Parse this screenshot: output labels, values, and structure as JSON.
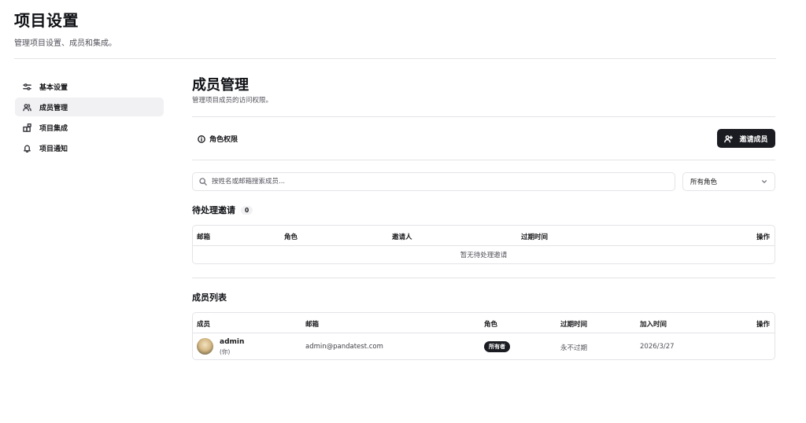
{
  "page": {
    "title": "项目设置",
    "subtitle": "管理项目设置、成员和集成。"
  },
  "sidebar": {
    "items": [
      {
        "label": "基本设置",
        "icon": "settings-sliders-icon",
        "active": false
      },
      {
        "label": "成员管理",
        "icon": "users-icon",
        "active": true
      },
      {
        "label": "项目集成",
        "icon": "puzzle-icon",
        "active": false
      },
      {
        "label": "项目通知",
        "icon": "bell-icon",
        "active": false
      }
    ]
  },
  "main": {
    "title": "成员管理",
    "subtitle": "管理项目成员的访问权限。",
    "role_permissions_label": "角色权限",
    "invite_button_label": "邀请成员",
    "search": {
      "placeholder": "按姓名或邮箱搜索成员...",
      "value": ""
    },
    "role_filter": {
      "selected": "所有角色"
    }
  },
  "pending_invites": {
    "title": "待处理邀请",
    "count": "0",
    "columns": [
      "邮箱",
      "角色",
      "邀请人",
      "过期时间",
      "操作"
    ],
    "empty_text": "暂无待处理邀请"
  },
  "members": {
    "title": "成员列表",
    "columns": [
      "成员",
      "邮箱",
      "角色",
      "过期时间",
      "加入时间",
      "操作"
    ],
    "rows": [
      {
        "name": "admin",
        "you_tag": "(你)",
        "email": "admin@pandatest.com",
        "role": "所有者",
        "expires": "永不过期",
        "joined": "2026/3/27"
      }
    ]
  },
  "colors": {
    "primary": "#1b1c22",
    "active_bg": "#f1f1f3",
    "border": "#e4e4e7",
    "muted_text": "#52525b"
  }
}
